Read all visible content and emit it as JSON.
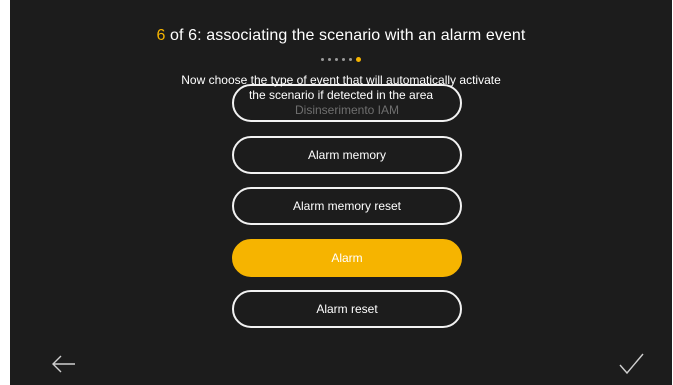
{
  "header": {
    "step": "6",
    "title_rest": " of 6: associating the scenario with an alarm event",
    "total_steps": 6,
    "current_step": 6
  },
  "description": {
    "line1": "Now choose the type of event that will automatically activate",
    "line2": "the scenario if detected in the area"
  },
  "options": [
    {
      "label": "Disinserimento IAM",
      "selected": false
    },
    {
      "label": "Alarm memory",
      "selected": false
    },
    {
      "label": "Alarm memory reset",
      "selected": false
    },
    {
      "label": "Alarm",
      "selected": true
    },
    {
      "label": "Alarm reset",
      "selected": false
    }
  ],
  "navigation": {
    "back_icon": "arrow-left-icon",
    "confirm_icon": "checkmark-icon"
  },
  "colors": {
    "background": "#1c1c1c",
    "accent": "#f6b400",
    "text": "#ffffff",
    "border": "#f2f2f2"
  }
}
